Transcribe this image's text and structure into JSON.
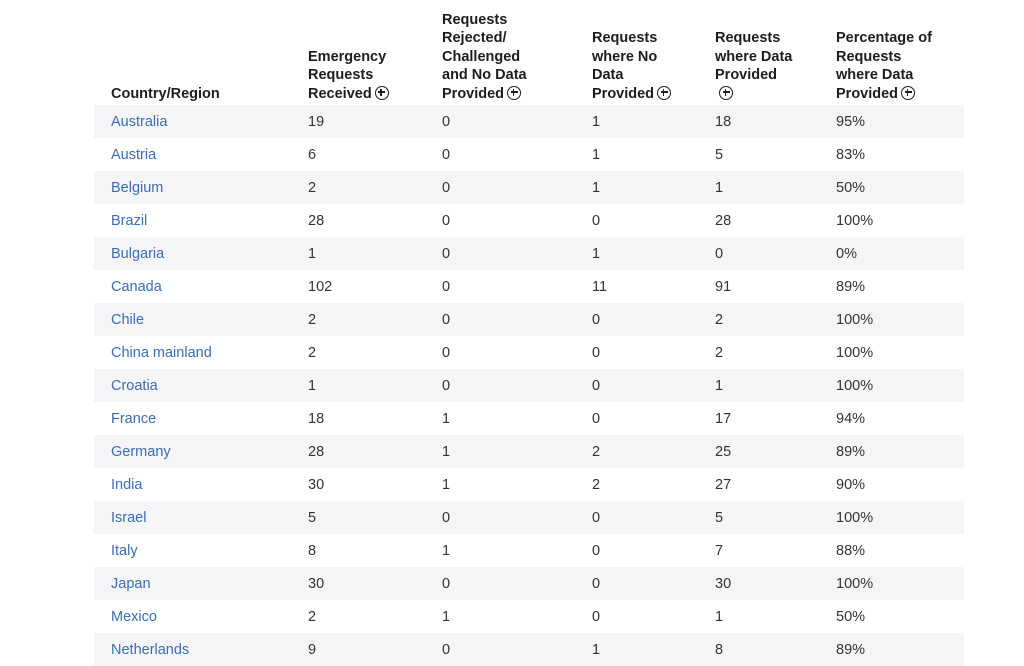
{
  "table": {
    "headers": [
      {
        "label": "Country/Region",
        "has_plus": false
      },
      {
        "label": "Emergency\nRequests\nReceived",
        "has_plus": true
      },
      {
        "label": "Requests\nRejected/\nChallenged\nand No Data\nProvided",
        "has_plus": true
      },
      {
        "label": "Requests\nwhere No\nData\nProvided",
        "has_plus": true
      },
      {
        "label": "Requests\nwhere Data\nProvided\n",
        "has_plus": true
      },
      {
        "label": "Percentage of\nRequests\nwhere Data\nProvided",
        "has_plus": true
      }
    ],
    "rows": [
      {
        "country": "Australia",
        "received": "19",
        "rejected": "0",
        "no_data": "1",
        "data_provided": "18",
        "percentage": "95%"
      },
      {
        "country": "Austria",
        "received": "6",
        "rejected": "0",
        "no_data": "1",
        "data_provided": "5",
        "percentage": "83%"
      },
      {
        "country": "Belgium",
        "received": "2",
        "rejected": "0",
        "no_data": "1",
        "data_provided": "1",
        "percentage": "50%"
      },
      {
        "country": "Brazil",
        "received": "28",
        "rejected": "0",
        "no_data": "0",
        "data_provided": "28",
        "percentage": "100%"
      },
      {
        "country": "Bulgaria",
        "received": "1",
        "rejected": "0",
        "no_data": "1",
        "data_provided": "0",
        "percentage": "0%"
      },
      {
        "country": "Canada",
        "received": "102",
        "rejected": "0",
        "no_data": "11",
        "data_provided": "91",
        "percentage": "89%"
      },
      {
        "country": "Chile",
        "received": "2",
        "rejected": "0",
        "no_data": "0",
        "data_provided": "2",
        "percentage": "100%"
      },
      {
        "country": "China mainland",
        "received": "2",
        "rejected": "0",
        "no_data": "0",
        "data_provided": "2",
        "percentage": "100%"
      },
      {
        "country": "Croatia",
        "received": "1",
        "rejected": "0",
        "no_data": "0",
        "data_provided": "1",
        "percentage": "100%"
      },
      {
        "country": "France",
        "received": "18",
        "rejected": "1",
        "no_data": "0",
        "data_provided": "17",
        "percentage": "94%"
      },
      {
        "country": "Germany",
        "received": "28",
        "rejected": "1",
        "no_data": "2",
        "data_provided": "25",
        "percentage": "89%"
      },
      {
        "country": "India",
        "received": "30",
        "rejected": "1",
        "no_data": "2",
        "data_provided": "27",
        "percentage": "90%"
      },
      {
        "country": "Israel",
        "received": "5",
        "rejected": "0",
        "no_data": "0",
        "data_provided": "5",
        "percentage": "100%"
      },
      {
        "country": "Italy",
        "received": "8",
        "rejected": "1",
        "no_data": "0",
        "data_provided": "7",
        "percentage": "88%"
      },
      {
        "country": "Japan",
        "received": "30",
        "rejected": "0",
        "no_data": "0",
        "data_provided": "30",
        "percentage": "100%"
      },
      {
        "country": "Mexico",
        "received": "2",
        "rejected": "1",
        "no_data": "0",
        "data_provided": "1",
        "percentage": "50%"
      },
      {
        "country": "Netherlands",
        "received": "9",
        "rejected": "0",
        "no_data": "1",
        "data_provided": "8",
        "percentage": "89%"
      }
    ]
  },
  "icons": {
    "header_expand": "plus-circle-icon"
  },
  "colors": {
    "link": "#3a6db5",
    "stripe": "#f5f5f7",
    "text": "#1d1d1f"
  }
}
